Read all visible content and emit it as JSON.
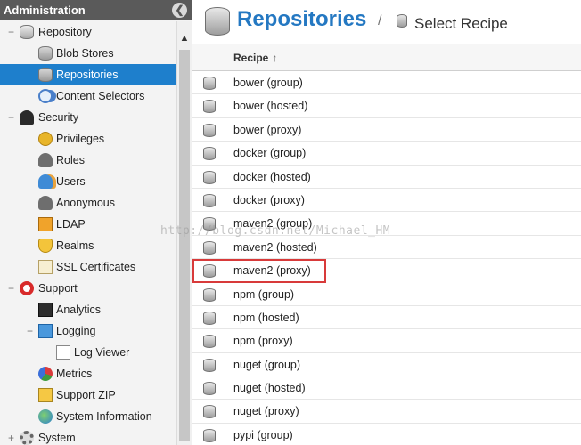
{
  "sidebar": {
    "header_title": "Administration",
    "collapse_glyph": "❮",
    "scroll_up_glyph": "▲",
    "items": [
      {
        "label": "Repository",
        "expander": "−",
        "icon": "repository-icon"
      },
      {
        "label": "Blob Stores",
        "icon": "blob-stores-icon"
      },
      {
        "label": "Repositories",
        "icon": "repositories-icon",
        "selected": true
      },
      {
        "label": "Content Selectors",
        "icon": "content-selectors-icon"
      },
      {
        "label": "Security",
        "expander": "−",
        "icon": "security-icon"
      },
      {
        "label": "Privileges",
        "icon": "privileges-icon"
      },
      {
        "label": "Roles",
        "icon": "roles-icon"
      },
      {
        "label": "Users",
        "icon": "users-icon"
      },
      {
        "label": "Anonymous",
        "icon": "anonymous-icon"
      },
      {
        "label": "LDAP",
        "icon": "ldap-icon"
      },
      {
        "label": "Realms",
        "icon": "realms-icon"
      },
      {
        "label": "SSL Certificates",
        "icon": "ssl-certificates-icon"
      },
      {
        "label": "Support",
        "expander": "−",
        "icon": "support-icon"
      },
      {
        "label": "Analytics",
        "icon": "analytics-icon"
      },
      {
        "label": "Logging",
        "expander": "−",
        "icon": "logging-icon"
      },
      {
        "label": "Log Viewer",
        "icon": "log-viewer-icon"
      },
      {
        "label": "Metrics",
        "icon": "metrics-icon"
      },
      {
        "label": "Support ZIP",
        "icon": "support-zip-icon"
      },
      {
        "label": "System Information",
        "icon": "system-information-icon"
      },
      {
        "label": "System",
        "expander": "+",
        "icon": "system-icon"
      }
    ]
  },
  "main": {
    "title": "Repositories",
    "separator": "/",
    "subtitle": "Select Recipe",
    "grid": {
      "column_header": "Recipe",
      "sort_glyph": "↑",
      "rows": [
        "bower (group)",
        "bower (hosted)",
        "bower (proxy)",
        "docker (group)",
        "docker (hosted)",
        "docker (proxy)",
        "maven2 (group)",
        "maven2 (hosted)",
        "maven2 (proxy)",
        "npm (group)",
        "npm (hosted)",
        "npm (proxy)",
        "nuget (group)",
        "nuget (hosted)",
        "nuget (proxy)",
        "pypi (group)"
      ],
      "highlighted_row": "maven2 (proxy)"
    }
  },
  "watermark": "http://blog.csdn.net/Michael_HM",
  "colors": {
    "selected_bg": "#1e7fcc",
    "title_blue": "#2478c2",
    "highlight_red": "#d83a3a"
  }
}
